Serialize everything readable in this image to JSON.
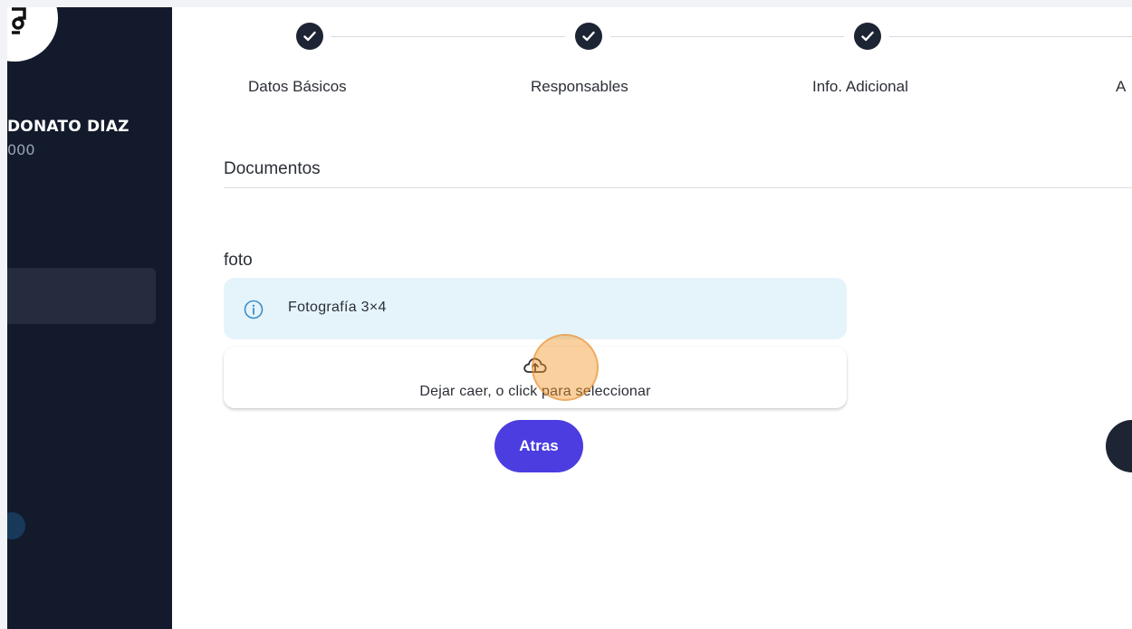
{
  "sidebar": {
    "user_name": "DONATO DIAZ",
    "user_id": "000"
  },
  "stepper": {
    "steps": [
      {
        "label": "Datos Básicos",
        "status": "completed"
      },
      {
        "label": "Responsables",
        "status": "completed"
      },
      {
        "label": "Info. Adicional",
        "status": "completed"
      },
      {
        "label": "A",
        "status": "active"
      }
    ]
  },
  "documents": {
    "section_title": "Documentos",
    "field_label": "foto",
    "info_text": "Fotografía 3×4",
    "dropzone_text": "Dejar caer, o click para seleccionar"
  },
  "actions": {
    "back_label": "Atras"
  },
  "colors": {
    "sidebar_bg": "#121a2b",
    "step_complete": "#1d2433",
    "primary_button": "#4b3ddf",
    "info_bg": "#e5f4fa"
  },
  "icons": {
    "step_check": "check-icon",
    "info": "info-circle-icon",
    "upload": "cloud-upload-icon"
  }
}
